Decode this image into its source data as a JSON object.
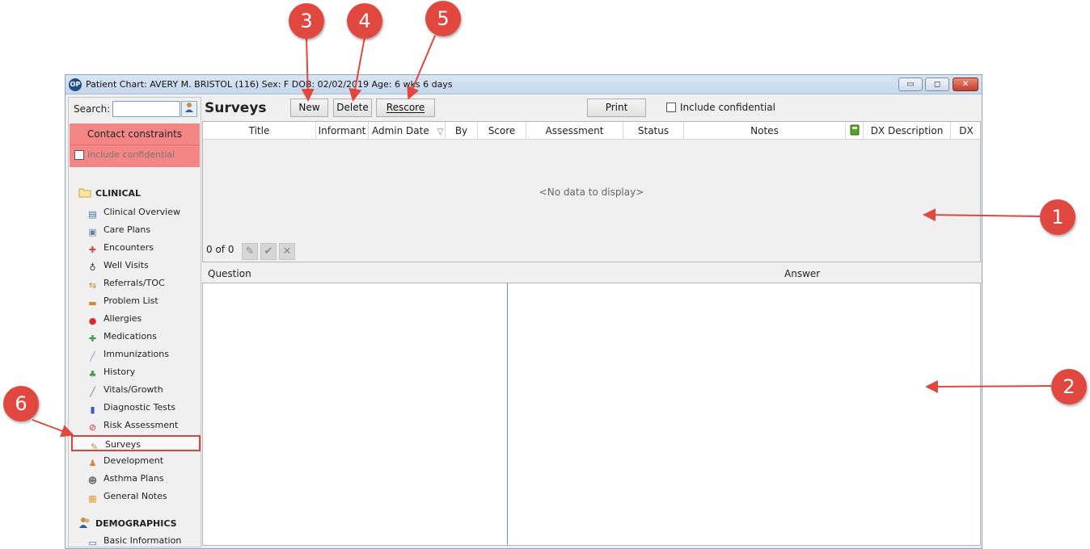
{
  "window": {
    "title": "Patient Chart: AVERY M. BRISTOL (116)  Sex: F  DOB: 02/02/2019  Age: 6 wks 6 days",
    "minimize_glyph": "▭",
    "maximize_glyph": "◻",
    "close_glyph": "✕"
  },
  "sidebar": {
    "search_label": "Search:",
    "search_value": "",
    "contact_constraints": "Contact constraints",
    "include_confidential": "Include confidential",
    "clinical_heading": "CLINICAL",
    "clinical_items": [
      {
        "label": "Clinical Overview",
        "icon": "book-icon"
      },
      {
        "label": "Care Plans",
        "icon": "care-plan-icon"
      },
      {
        "label": "Encounters",
        "icon": "encounter-icon"
      },
      {
        "label": "Well Visits",
        "icon": "stethoscope-icon"
      },
      {
        "label": "Referrals/TOC",
        "icon": "referral-icon"
      },
      {
        "label": "Problem List",
        "icon": "problem-list-icon"
      },
      {
        "label": "Allergies",
        "icon": "allergy-icon"
      },
      {
        "label": "Medications",
        "icon": "medication-icon"
      },
      {
        "label": "Immunizations",
        "icon": "syringe-icon"
      },
      {
        "label": "History",
        "icon": "family-tree-icon"
      },
      {
        "label": "Vitals/Growth",
        "icon": "vitals-icon"
      },
      {
        "label": "Diagnostic Tests",
        "icon": "test-tubes-icon"
      },
      {
        "label": "Risk Assessment",
        "icon": "no-symbol-icon"
      },
      {
        "label": "Surveys",
        "icon": "survey-clipboard-icon"
      },
      {
        "label": "Development",
        "icon": "development-icon"
      },
      {
        "label": "Asthma Plans",
        "icon": "asthma-icon"
      },
      {
        "label": "General Notes",
        "icon": "notes-icon"
      }
    ],
    "demographics_heading": "DEMOGRAPHICS",
    "demographics_items": [
      {
        "label": "Basic Information",
        "icon": "id-card-icon"
      }
    ]
  },
  "main": {
    "title": "Surveys",
    "new_label": "New",
    "delete_label": "Delete",
    "rescore_label": "Rescore",
    "print_label": "Print",
    "include_confidential": "Include confidential",
    "columns": [
      "Title",
      "Informant",
      "Admin Date",
      "By",
      "Score",
      "Assessment",
      "Status",
      "Notes",
      "",
      "DX Description",
      "DX"
    ],
    "sort_glyph": "▽",
    "no_data": "<No data to display>",
    "pager": "0 of 0",
    "question_header": "Question",
    "answer_header": "Answer"
  },
  "callouts": [
    "1",
    "2",
    "3",
    "4",
    "5",
    "6"
  ],
  "colors": {
    "callout": "#e0473e",
    "constraints_bg": "#f58686",
    "selection_border": "#d9453d"
  }
}
